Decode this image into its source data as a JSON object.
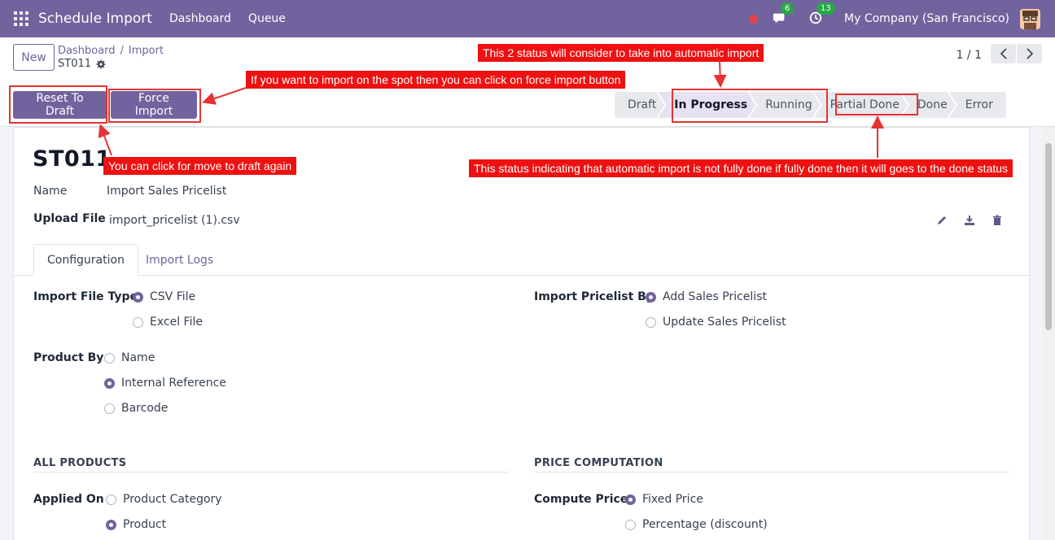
{
  "navbar": {
    "app_title": "Schedule Import",
    "menu": [
      "Dashboard",
      "Queue"
    ],
    "messages_count": "6",
    "activities_count": "13",
    "company": "My Company (San Francisco)"
  },
  "control": {
    "new_label": "New",
    "breadcrumb": [
      "Dashboard",
      "Import"
    ],
    "record_name": "ST011",
    "pager": "1 / 1"
  },
  "actions": {
    "reset_label": "Reset To Draft",
    "force_label": "Force Import"
  },
  "statusbar": {
    "stages": [
      "Draft",
      "In Progress",
      "Running",
      "Partial Done",
      "Done",
      "Error"
    ],
    "active": "In Progress"
  },
  "form": {
    "title": "ST011",
    "name_label": "Name",
    "name_value": "Import Sales Pricelist",
    "upload_label": "Upload File",
    "upload_value": "import_pricelist (1).csv",
    "tabs": [
      "Configuration",
      "Import Logs"
    ],
    "file_type_label": "Import File Type",
    "file_type_options": [
      "CSV File",
      "Excel File"
    ],
    "file_type_selected": "CSV File",
    "pricelist_by_label": "Import Pricelist By",
    "pricelist_by_options": [
      "Add Sales Pricelist",
      "Update Sales Pricelist"
    ],
    "pricelist_by_selected": "Add Sales Pricelist",
    "product_by_label": "Product By",
    "product_by_options": [
      "Name",
      "Internal Reference",
      "Barcode"
    ],
    "product_by_selected": "Internal Reference",
    "section_all_products": "ALL PRODUCTS",
    "section_price": "PRICE COMPUTATION",
    "applied_on_label": "Applied On",
    "applied_on_options": [
      "Product Category",
      "Product"
    ],
    "applied_on_selected": "Product",
    "compute_price_label": "Compute Price",
    "compute_price_options": [
      "Fixed Price",
      "Percentage (discount)"
    ],
    "compute_price_selected": "Fixed Price"
  },
  "annotations": {
    "status_note": "This 2 status will consider to take into automatic import",
    "force_note": "If you want to import on the spot then you can click on force import button",
    "draft_note": "You can click for move to draft again",
    "partial_note": "This status indicating that automatic import is not fully done if fully done then it will goes to the done status"
  },
  "colors": {
    "brand": "#71639e",
    "annotation": "#ee1111"
  }
}
